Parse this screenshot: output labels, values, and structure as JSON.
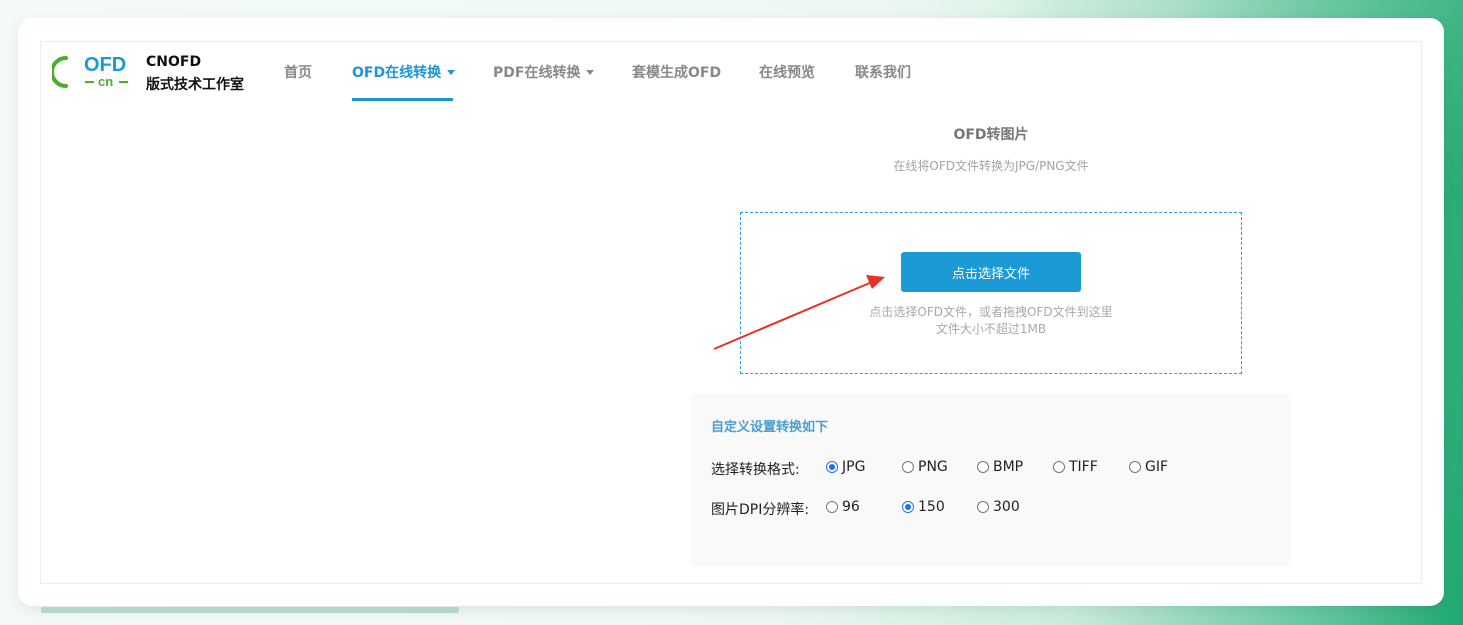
{
  "brand": {
    "logo_text": "OFD",
    "logo_sub": "cn",
    "title": "CNOFD",
    "subtitle": "版式技术工作室"
  },
  "nav": {
    "items": [
      {
        "label": "首页",
        "active": false,
        "dropdown": false
      },
      {
        "label": "OFD在线转换",
        "active": true,
        "dropdown": true
      },
      {
        "label": "PDF在线转换",
        "active": false,
        "dropdown": true
      },
      {
        "label": "套模生成OFD",
        "active": false,
        "dropdown": false
      },
      {
        "label": "在线预览",
        "active": false,
        "dropdown": false
      },
      {
        "label": "联系我们",
        "active": false,
        "dropdown": false
      }
    ]
  },
  "page": {
    "title": "OFD转图片",
    "subtitle": "在线将OFD文件转换为JPG/PNG文件"
  },
  "upload": {
    "button_label": "点击选择文件",
    "hint_line1": "点击选择OFD文件，或者拖拽OFD文件到这里",
    "hint_line2": "文件大小不超过1MB"
  },
  "settings": {
    "title": "自定义设置转换如下",
    "format": {
      "label": "选择转换格式:",
      "options": [
        "JPG",
        "PNG",
        "BMP",
        "TIFF",
        "GIF"
      ],
      "selected": "JPG"
    },
    "dpi": {
      "label": "图片DPI分辨率:",
      "options": [
        "96",
        "150",
        "300"
      ],
      "selected": "150"
    }
  },
  "colors": {
    "accent": "#1b96d3",
    "button": "#1b9ad6",
    "logo_green": "#4caf2a",
    "arrow": "#e8302a"
  }
}
